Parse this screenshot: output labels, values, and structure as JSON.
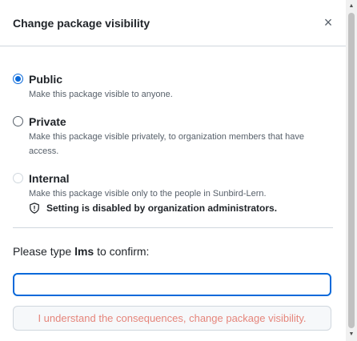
{
  "dialog": {
    "title": "Change package visibility",
    "close_icon": "×"
  },
  "options": [
    {
      "label": "Public",
      "description": "Make this package visible to anyone.",
      "state": "checked"
    },
    {
      "label": "Private",
      "description": "Make this package visible privately, to organization members that have access.",
      "state": "unchecked"
    },
    {
      "label": "Internal",
      "description": "Make this package visible only to the people in Sunbird-Lern.",
      "state": "disabled",
      "note": "Setting is disabled by organization administrators."
    }
  ],
  "confirm": {
    "prefix": "Please type ",
    "package_name": "lms",
    "suffix": " to confirm:",
    "input_value": "",
    "button_label": "I understand the consequences, change package visibility."
  },
  "colors": {
    "accent": "#0969da",
    "danger_text": "#e5857b",
    "border": "#d0d7de"
  },
  "icons": {
    "close": "close-icon",
    "shield": "shield-icon"
  }
}
